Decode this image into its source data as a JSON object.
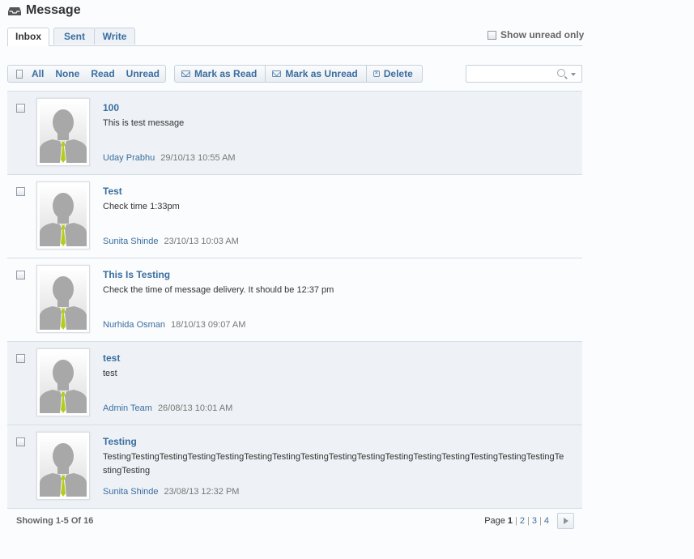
{
  "page": {
    "title": "Message"
  },
  "tabs": [
    {
      "label": "Inbox",
      "active": true
    },
    {
      "label": "Sent",
      "active": false
    },
    {
      "label": "Write",
      "active": false
    }
  ],
  "filters": {
    "show_unread_label": "Show unread only"
  },
  "toolbar": {
    "select_all": "All",
    "select_none": "None",
    "select_read": "Read",
    "select_unread": "Unread",
    "mark_read": "Mark as Read",
    "mark_unread": "Mark as Unread",
    "delete": "Delete"
  },
  "search": {
    "value": "",
    "placeholder": ""
  },
  "messages": [
    {
      "title": "100",
      "body": "This is test message",
      "sender": "Uday Prabhu",
      "date": "29/10/13 10:55 AM",
      "highlighted": true
    },
    {
      "title": "Test",
      "body": "Check time 1:33pm",
      "sender": "Sunita Shinde",
      "date": "23/10/13 10:03 AM",
      "highlighted": false
    },
    {
      "title": "This Is Testing",
      "body": "Check the time of message delivery. It should be 12:37 pm",
      "sender": "Nurhida Osman",
      "date": "18/10/13 09:07 AM",
      "highlighted": false
    },
    {
      "title": "test",
      "body": "test",
      "sender": "Admin Team",
      "date": "26/08/13 10:01 AM",
      "highlighted": true
    },
    {
      "title": "Testing",
      "body": "TestingTestingTestingTestingTestingTestingTestingTestingTestingTestingTestingTestingTestingTestingTestingTestingTestingTesting",
      "sender": "Sunita Shinde",
      "date": "23/08/13 12:32 PM",
      "highlighted": true
    }
  ],
  "footer": {
    "showing": "Showing 1-5 Of 16",
    "page_label": "Page",
    "current_page": "1",
    "pages": [
      "2",
      "3",
      "4"
    ],
    "separator": "|"
  },
  "colors": {
    "link": "#3a6e9f",
    "row_highlight": "#eef2f6",
    "tie": "#b5cc1f"
  },
  "icons": {
    "header": "inbox-tray-icon",
    "mark_read": "envelope-open-icon",
    "mark_unread": "envelope-icon",
    "delete": "delete-icon",
    "search": "search-icon",
    "next": "chevron-right-icon"
  }
}
